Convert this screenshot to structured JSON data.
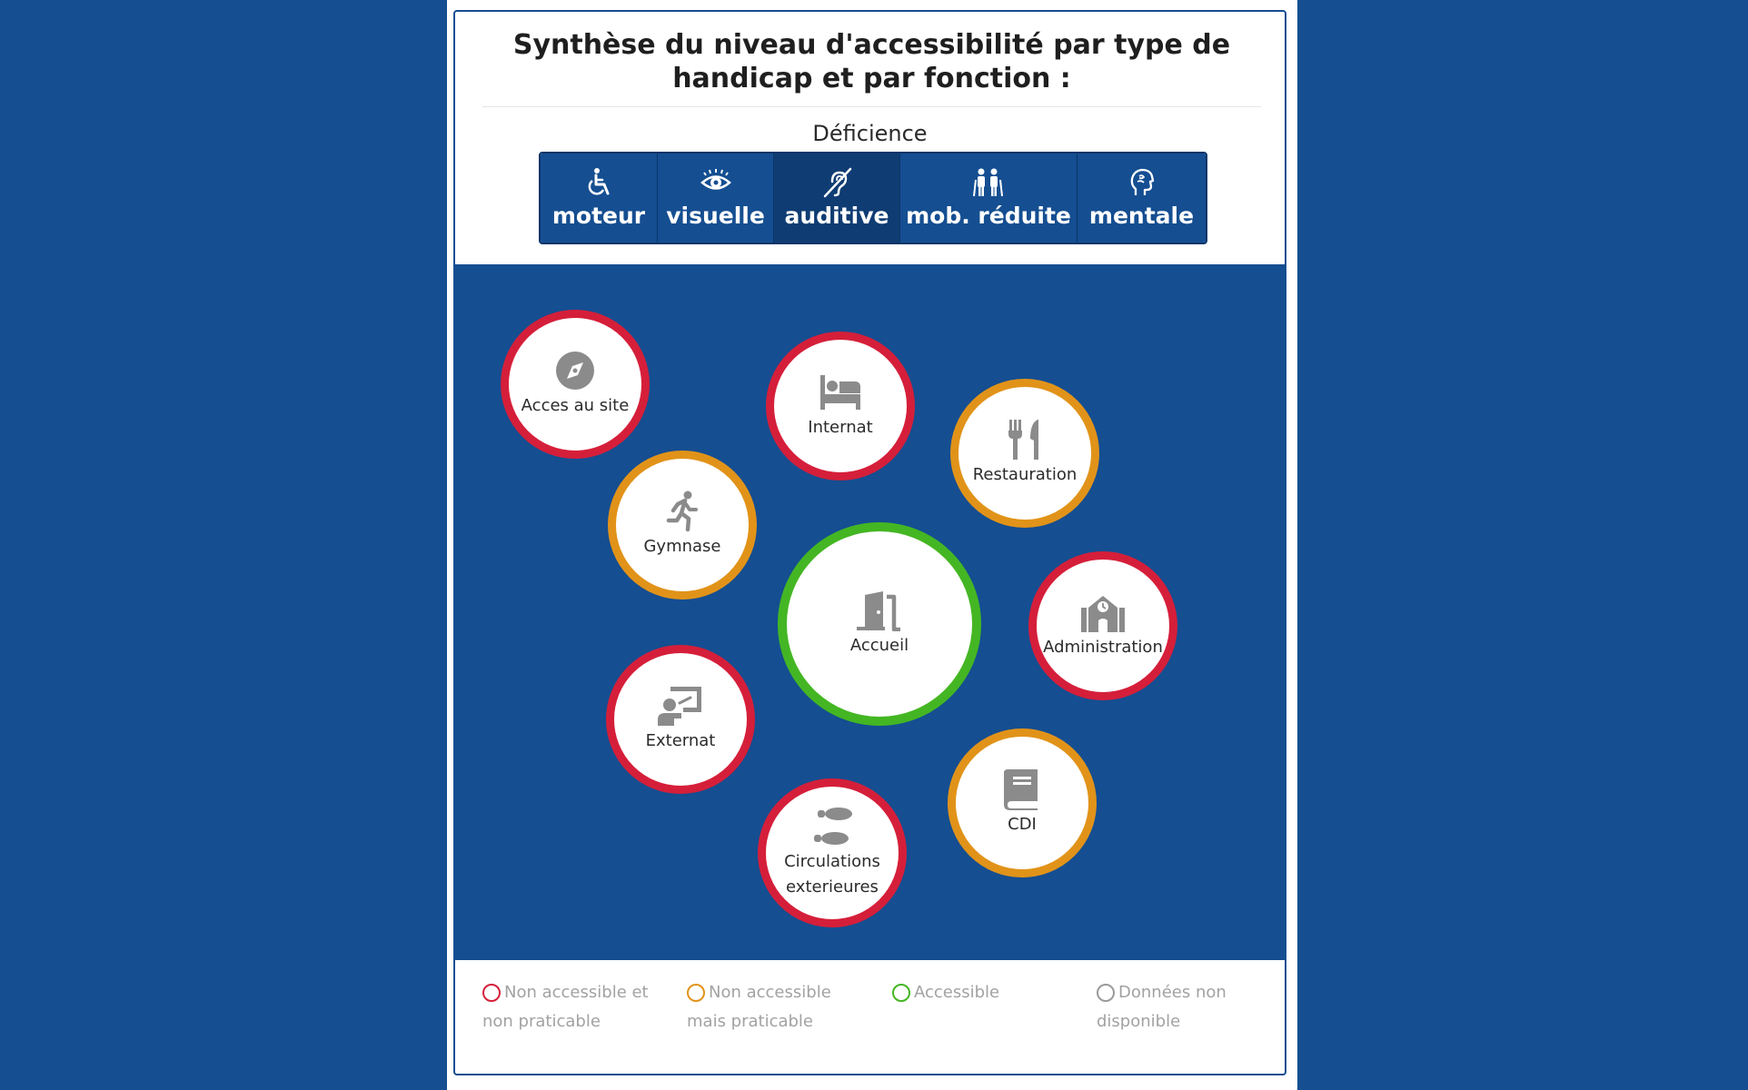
{
  "title": "Synthèse du niveau d'accessibilité par type de handicap et par fonction :",
  "deficience_label": "Déficience",
  "tabs": [
    {
      "label": "moteur",
      "icon": "wheelchair-icon",
      "active": false
    },
    {
      "label": "visuelle",
      "icon": "eye-icon",
      "active": false
    },
    {
      "label": "auditive",
      "icon": "deaf-ear-icon",
      "active": true
    },
    {
      "label": "mob. réduite",
      "icon": "elderly-people-icon",
      "active": false
    },
    {
      "label": "mentale",
      "icon": "head-profile-icon",
      "active": false
    }
  ],
  "functions": [
    {
      "label": "Acces au site",
      "icon": "compass-icon",
      "status": "non-accessible-non-praticable"
    },
    {
      "label": "Internat",
      "icon": "bed-icon",
      "status": "non-accessible-non-praticable"
    },
    {
      "label": "Restauration",
      "icon": "cutlery-icon",
      "status": "non-accessible-praticable"
    },
    {
      "label": "Gymnase",
      "icon": "running-person-icon",
      "status": "non-accessible-praticable"
    },
    {
      "label": "Accueil",
      "icon": "door-icon",
      "status": "accessible"
    },
    {
      "label": "Administration",
      "icon": "school-building-icon",
      "status": "non-accessible-non-praticable"
    },
    {
      "label": "Externat",
      "icon": "classroom-icon",
      "status": "non-accessible-non-praticable"
    },
    {
      "label": "CDI",
      "icon": "book-icon",
      "status": "non-accessible-praticable"
    },
    {
      "label": "Circulations exterieures",
      "icon": "footprints-icon",
      "status": "non-accessible-non-praticable"
    }
  ],
  "legend": [
    {
      "label": "Non accessible et non praticable",
      "color": "#d51f3a"
    },
    {
      "label": "Non accessible mais praticable",
      "color": "#e19319"
    },
    {
      "label": "Accessible",
      "color": "#44b623"
    },
    {
      "label": "Données non disponible",
      "color": "#9a9a9a"
    }
  ],
  "colors": {
    "background": "#154e91",
    "tab_active": "#0f3c72",
    "icon_grey": "#8b8b8b"
  }
}
